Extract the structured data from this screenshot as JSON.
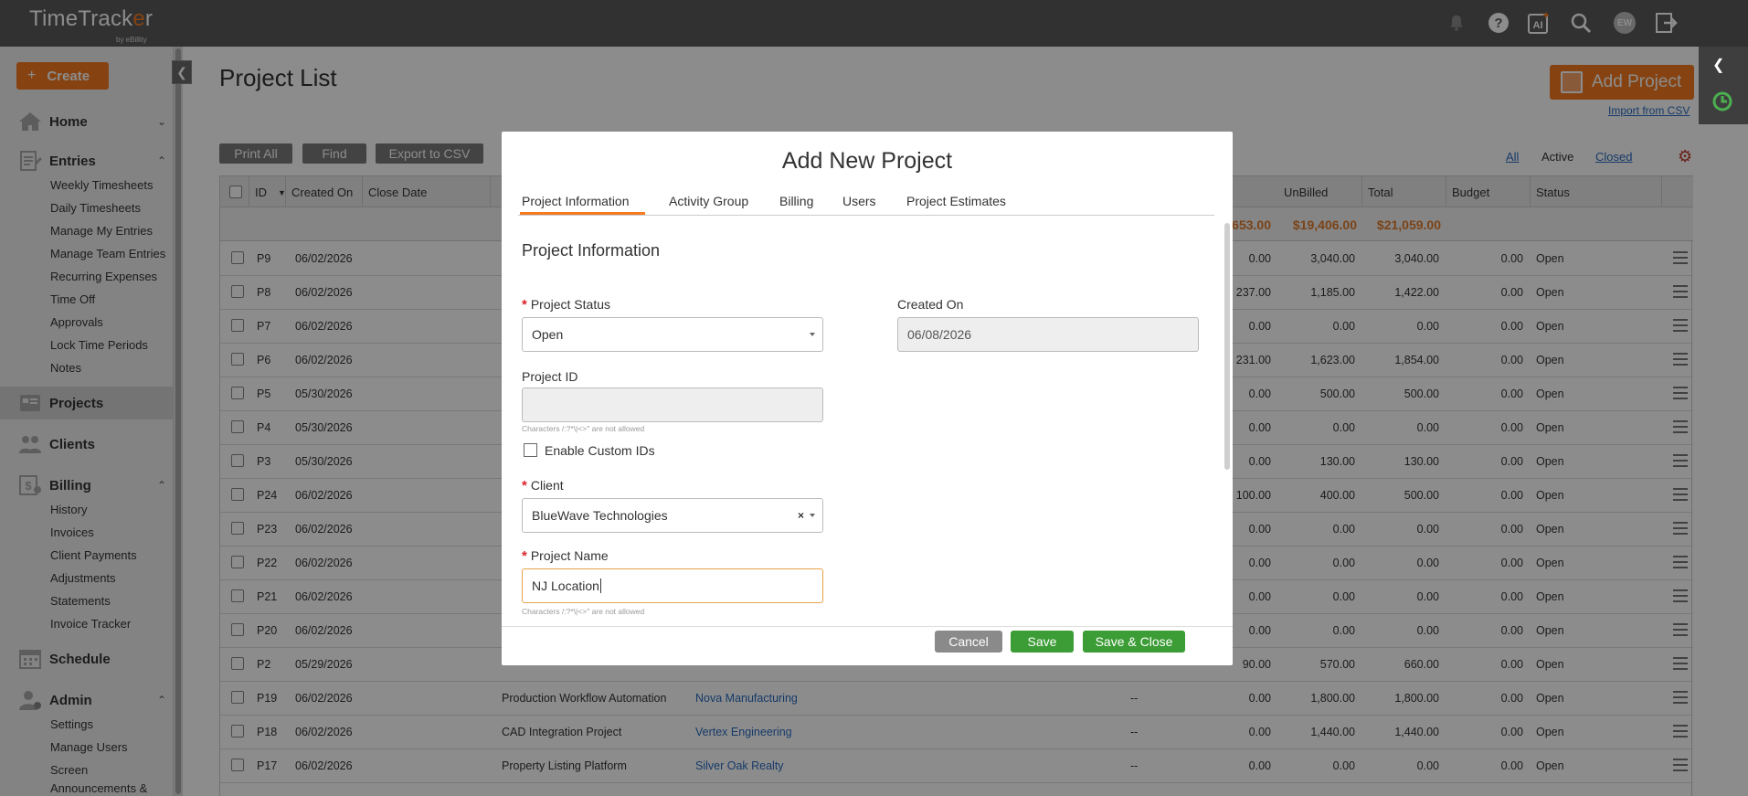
{
  "app": {
    "name_a": "TimeTrack",
    "name_o": "e",
    "name_b": "r",
    "by": "by eBillity",
    "avatar_initials": "EW",
    "ai_label": "AI"
  },
  "sidebar": {
    "create_label": "Create",
    "sections": {
      "home": "Home",
      "entries": "Entries",
      "projects": "Projects",
      "clients": "Clients",
      "billing": "Billing",
      "schedule": "Schedule",
      "admin": "Admin"
    },
    "entries_items": [
      "Weekly Timesheets",
      "Daily Timesheets",
      "Manage My Entries",
      "Manage Team Entries",
      "Recurring Expenses",
      "Time Off",
      "Approvals",
      "Lock Time Periods",
      "Notes"
    ],
    "billing_items": [
      "History",
      "Invoices",
      "Client Payments",
      "Adjustments",
      "Statements",
      "Invoice Tracker"
    ],
    "admin_items": [
      "Settings",
      "Manage Users",
      "Screen",
      "Announcements &"
    ]
  },
  "main": {
    "title": "Project List",
    "add_project": "Add Project",
    "import_csv": "Import from CSV",
    "toolbar": {
      "print_all": "Print All",
      "find": "Find",
      "export_csv": "Export to CSV"
    },
    "filters": {
      "all": "All",
      "active": "Active",
      "closed": "Closed"
    },
    "columns": {
      "id": "ID",
      "created_on": "Created On",
      "close_date": "Close Date",
      "unbilled": "UnBilled",
      "total": "Total",
      "budget": "Budget",
      "status": "Status"
    },
    "totals": {
      "billed": "653.00",
      "unbilled": "$19,406.00",
      "total": "$21,059.00"
    },
    "rows": [
      {
        "id": "P9",
        "created": "06/02/2026",
        "name": "",
        "client": "",
        "dash": "",
        "billed": "0.00",
        "unbilled": "3,040.00",
        "total": "3,040.00",
        "budget": "0.00",
        "status": "Open"
      },
      {
        "id": "P8",
        "created": "06/02/2026",
        "name": "",
        "client": "",
        "dash": "",
        "billed": "237.00",
        "unbilled": "1,185.00",
        "total": "1,422.00",
        "budget": "0.00",
        "status": "Open"
      },
      {
        "id": "P7",
        "created": "06/02/2026",
        "name": "",
        "client": "",
        "dash": "",
        "billed": "0.00",
        "unbilled": "0.00",
        "total": "0.00",
        "budget": "0.00",
        "status": "Open"
      },
      {
        "id": "P6",
        "created": "06/02/2026",
        "name": "",
        "client": "",
        "dash": "",
        "billed": "231.00",
        "unbilled": "1,623.00",
        "total": "1,854.00",
        "budget": "0.00",
        "status": "Open"
      },
      {
        "id": "P5",
        "created": "05/30/2026",
        "name": "",
        "client": "",
        "dash": "",
        "billed": "0.00",
        "unbilled": "500.00",
        "total": "500.00",
        "budget": "0.00",
        "status": "Open"
      },
      {
        "id": "P4",
        "created": "05/30/2026",
        "name": "",
        "client": "",
        "dash": "",
        "billed": "0.00",
        "unbilled": "0.00",
        "total": "0.00",
        "budget": "0.00",
        "status": "Open"
      },
      {
        "id": "P3",
        "created": "05/30/2026",
        "name": "",
        "client": "",
        "dash": "",
        "billed": "0.00",
        "unbilled": "130.00",
        "total": "130.00",
        "budget": "0.00",
        "status": "Open"
      },
      {
        "id": "P24",
        "created": "06/02/2026",
        "name": "",
        "client": "",
        "dash": "",
        "billed": "100.00",
        "unbilled": "400.00",
        "total": "500.00",
        "budget": "0.00",
        "status": "Open"
      },
      {
        "id": "P23",
        "created": "06/02/2026",
        "name": "",
        "client": "",
        "dash": "",
        "billed": "0.00",
        "unbilled": "0.00",
        "total": "0.00",
        "budget": "0.00",
        "status": "Open"
      },
      {
        "id": "P22",
        "created": "06/02/2026",
        "name": "",
        "client": "",
        "dash": "",
        "billed": "0.00",
        "unbilled": "0.00",
        "total": "0.00",
        "budget": "0.00",
        "status": "Open"
      },
      {
        "id": "P21",
        "created": "06/02/2026",
        "name": "",
        "client": "",
        "dash": "",
        "billed": "0.00",
        "unbilled": "0.00",
        "total": "0.00",
        "budget": "0.00",
        "status": "Open"
      },
      {
        "id": "P20",
        "created": "06/02/2026",
        "name": "",
        "client": "",
        "dash": "",
        "billed": "0.00",
        "unbilled": "0.00",
        "total": "0.00",
        "budget": "0.00",
        "status": "Open"
      },
      {
        "id": "P2",
        "created": "05/29/2026",
        "name": "",
        "client": "",
        "dash": "",
        "billed": "90.00",
        "unbilled": "570.00",
        "total": "660.00",
        "budget": "0.00",
        "status": "Open"
      },
      {
        "id": "P19",
        "created": "06/02/2026",
        "name": "Production Workflow Automation",
        "client": "Nova Manufacturing",
        "dash": "--",
        "billed": "0.00",
        "unbilled": "1,800.00",
        "total": "1,800.00",
        "budget": "0.00",
        "status": "Open"
      },
      {
        "id": "P18",
        "created": "06/02/2026",
        "name": "CAD Integration Project",
        "client": "Vertex Engineering",
        "dash": "--",
        "billed": "0.00",
        "unbilled": "1,440.00",
        "total": "1,440.00",
        "budget": "0.00",
        "status": "Open"
      },
      {
        "id": "P17",
        "created": "06/02/2026",
        "name": "Property Listing Platform",
        "client": "Silver Oak Realty",
        "dash": "--",
        "billed": "0.00",
        "unbilled": "0.00",
        "total": "0.00",
        "budget": "0.00",
        "status": "Open"
      }
    ]
  },
  "modal": {
    "title": "Add New Project",
    "tabs": [
      "Project Information",
      "Activity Group",
      "Billing",
      "Users",
      "Project Estimates"
    ],
    "section_title": "Project Information",
    "project_status_label": "Project Status",
    "project_status_value": "Open",
    "created_on_label": "Created On",
    "created_on_value": "06/08/2026",
    "project_id_label": "Project ID",
    "project_id_value": "",
    "chars_hint": "Characters /:?*\\|<>\" are not allowed",
    "enable_custom_ids": "Enable Custom IDs",
    "client_label": "Client",
    "client_value": "BlueWave Technologies",
    "project_name_label": "Project Name",
    "project_name_value": "NJ Location",
    "buttons": {
      "cancel": "Cancel",
      "save": "Save",
      "save_close": "Save & Close"
    }
  },
  "colors": {
    "accent": "#f47b20",
    "topbar": "#5a5a5a",
    "save": "#3c9c35",
    "link": "#2a6bbf",
    "required": "#d9232d"
  }
}
